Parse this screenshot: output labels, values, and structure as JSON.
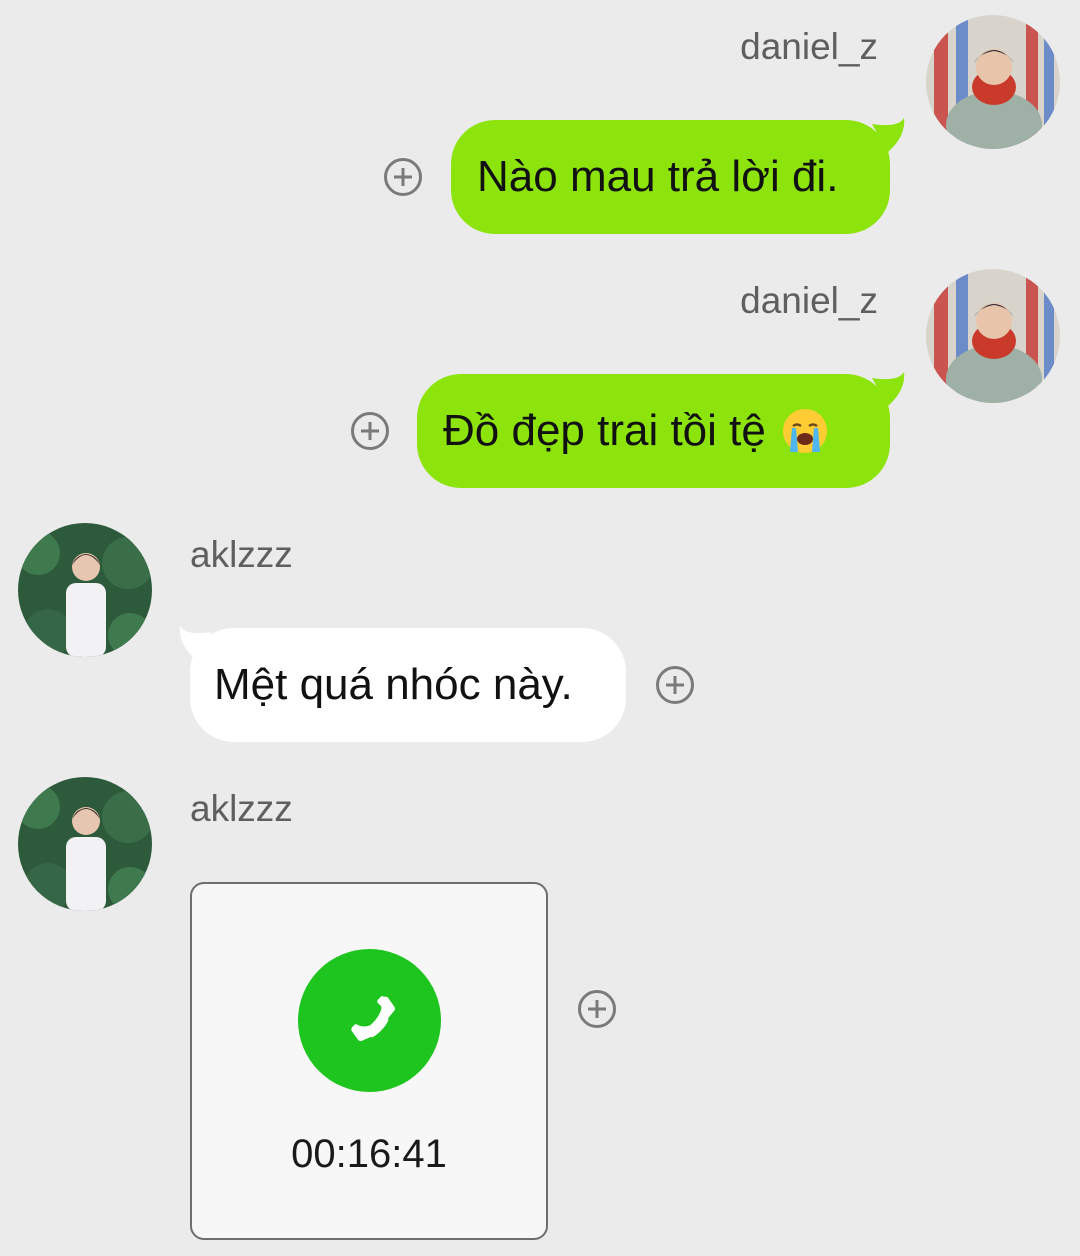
{
  "messages": [
    {
      "sender": "daniel_z",
      "side": "right",
      "text": "Nào mau trả lời đi."
    },
    {
      "sender": "daniel_z",
      "side": "right",
      "text": "Đồ đẹp trai tồi tệ",
      "emoji_icon": "loudly-crying-face-icon"
    },
    {
      "sender": "aklzzz",
      "side": "left",
      "text": "Mệt quá nhóc này."
    },
    {
      "sender": "aklzzz",
      "side": "left",
      "type": "call",
      "call_icon": "phone-icon",
      "call_duration": "00:16:41"
    }
  ],
  "colors": {
    "background": "#ebebeb",
    "outgoing_bubble": "#8de40c",
    "incoming_bubble": "#ffffff",
    "call_icon_bg": "#1ec51e",
    "username": "#5f5f5f",
    "plus_icon": "#7a7a7a"
  },
  "icons": {
    "add_reaction": "plus-circle-icon"
  }
}
